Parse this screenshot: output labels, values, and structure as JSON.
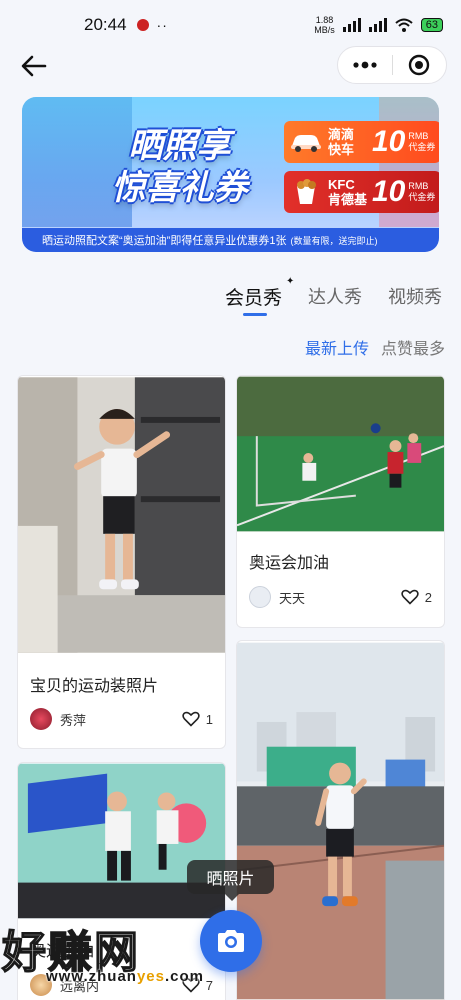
{
  "status_bar": {
    "time": "20:44",
    "more": "··",
    "net_speed": "1.88",
    "net_unit": "MB/s",
    "battery": "63"
  },
  "nav": {
    "back_icon": "back-arrow-icon",
    "menu_icon": "more-dots-icon",
    "close_icon": "target-close-icon"
  },
  "banner": {
    "title_line1": "晒照享",
    "title_line2": "惊喜礼券",
    "coupons": [
      {
        "brand_line1": "滴滴",
        "brand_line2": "快车",
        "amount": "10",
        "unit_line1": "RMB",
        "unit_line2": "代金券",
        "color": "#ff5a22"
      },
      {
        "brand_line1": "KFC",
        "brand_line2": "肯德基",
        "amount": "10",
        "unit_line1": "RMB",
        "unit_line2": "代金券",
        "color": "#d4231f"
      }
    ],
    "footer": "晒运动照配文案“奥运加油”即得任意异业优惠券1张",
    "footer_note": "(数量有限，送完即止)"
  },
  "tabs": [
    {
      "label": "会员秀",
      "active": true
    },
    {
      "label": "达人秀",
      "active": false
    },
    {
      "label": "视频秀",
      "active": false
    }
  ],
  "sort": {
    "latest": "最新上传",
    "most_liked": "点赞最多"
  },
  "posts": [
    {
      "title": "宝贝的运动装照片",
      "author": "秀萍",
      "likes": "1"
    },
    {
      "title": "奥运会加油",
      "author": "天天",
      "likes": "2"
    },
    {
      "title": "奥运加油",
      "author": "远离内",
      "likes": "7"
    }
  ],
  "fab": {
    "tooltip": "晒照片",
    "icon": "camera-icon"
  },
  "watermark": {
    "text": "好赚网",
    "url_prefix": "www.zhuan",
    "url_mid": "yes",
    "url_suffix": ".com"
  },
  "colors": {
    "accent": "#2f6ee8",
    "banner_foot": "#2b5de0"
  }
}
